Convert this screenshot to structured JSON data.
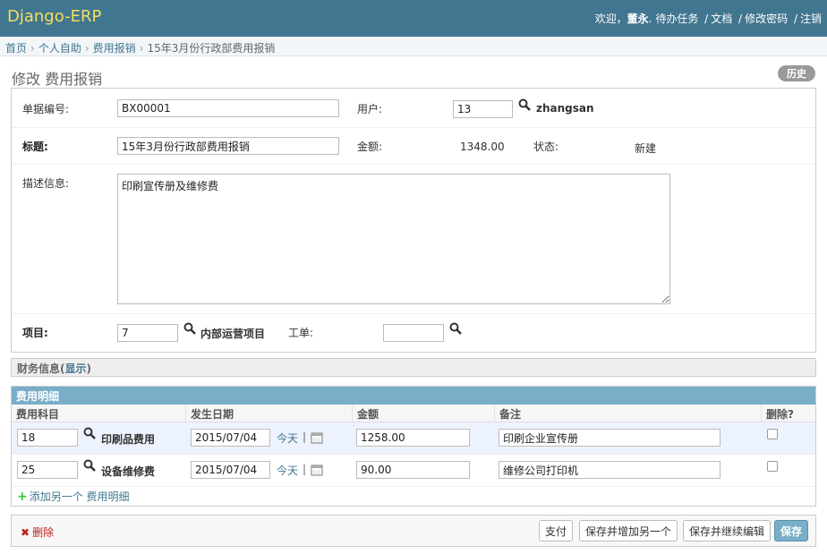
{
  "header": {
    "brand": "Django-ERP",
    "welcome": "欢迎，",
    "username": "董永",
    "tasks": ". 待办任务",
    "docs": "文档",
    "change_password": "修改密码",
    "logout": "注销",
    "separator": "/"
  },
  "breadcrumbs": {
    "home": "首页",
    "self_service": "个人自助",
    "expense": "费用报销",
    "current": "15年3月份行政部费用报销",
    "arrow": "›"
  },
  "page": {
    "title": "修改 费用报销",
    "history": "历史"
  },
  "form": {
    "bill_no_label": "单据编号:",
    "bill_no": "BX00001",
    "user_label": "用户:",
    "user_id": "13",
    "user_name": "zhangsan",
    "title_label": "标题:",
    "title": "15年3月份行政部费用报销",
    "amount_label": "金额:",
    "amount": "1348.00",
    "status_label": "状态:",
    "status": "新建",
    "desc_label": "描述信息:",
    "desc": "印刷宣传册及维修费",
    "project_label": "项目:",
    "project_id": "7",
    "project_name": "内部运营项目",
    "workorder_label": "工单:",
    "workorder": ""
  },
  "finance": {
    "title": "财务信息",
    "show": "显示",
    "paren_open": "(",
    "paren_close": ")"
  },
  "inline": {
    "title": "费用明细",
    "columns": [
      "费用科目",
      "发生日期",
      "金额",
      "备注",
      "删除?"
    ],
    "today": "今天",
    "pipe": "|",
    "rows": [
      {
        "account_id": "18",
        "account_name": "印刷品费用",
        "date": "2015/07/04",
        "amount": "1258.00",
        "note": "印刷企业宣传册"
      },
      {
        "account_id": "25",
        "account_name": "设备维修费",
        "date": "2015/07/04",
        "amount": "90.00",
        "note": "维修公司打印机"
      }
    ],
    "add_another": "添加另一个 费用明细",
    "add_icon": "+"
  },
  "submit": {
    "delete": "删除",
    "delete_icon": "✖",
    "pay": "支付",
    "save_add": "保存并增加另一个",
    "save_continue": "保存并继续编辑",
    "save": "保存"
  },
  "colors": {
    "header_bg": "#417690",
    "brand": "#f5dd5d",
    "inline_head": "#79aec8",
    "link": "#417690",
    "delete": "#ba2121"
  }
}
